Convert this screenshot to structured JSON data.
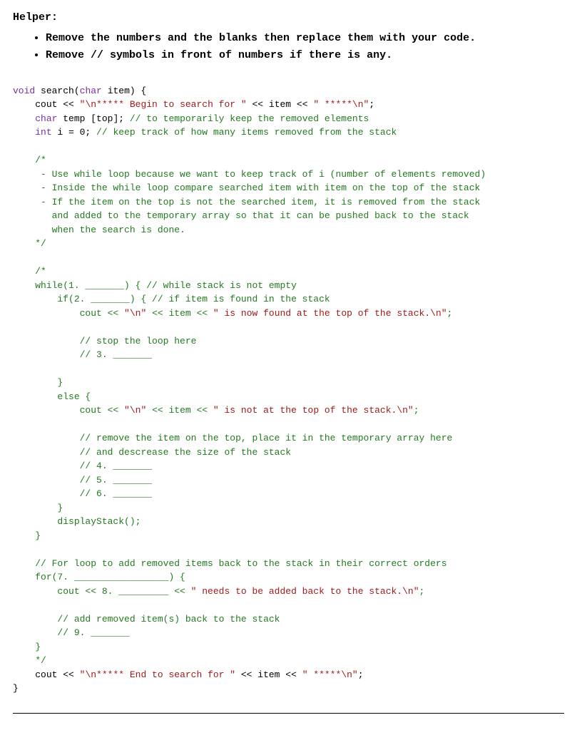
{
  "header": {
    "title": "Helper:",
    "bullets": [
      "Remove the numbers and the blanks then replace them with your code.",
      "Remove // symbols in front of numbers if there is any."
    ]
  },
  "code": {
    "sig_void": "void",
    "sig_name": "search",
    "sig_char": "char",
    "sig_param": "item",
    "l1_cout": "cout << ",
    "l1_str1": "\"\\n***** Begin to search for \"",
    "l1_mid": " << item << ",
    "l1_str2": "\" *****\\n\"",
    "l1_end": ";",
    "l2_char": "char",
    "l2_rest": " temp [top]; ",
    "l2_cmt": "// to temporarily keep the removed elements",
    "l3_int": "int",
    "l3_rest": " i = 0; ",
    "l3_cmt": "// keep track of how many items removed from the stack",
    "block1_open": "/*",
    "block1_a": " - Use while loop because we want to keep track of i (number of elements removed)",
    "block1_b": " - Inside the while loop compare searched item with item on the top of the stack",
    "block1_c": " - If the item on the top is not the searched item, it is removed from the stack",
    "block1_d": "   and added to the temporary array so that it can be pushed back to the stack",
    "block1_e": "   when the search is done.",
    "block1_close": "*/",
    "block2_open": "/*",
    "while_line": "while(1. _______) { // while stack is not empty",
    "if_line": "    if(2. _______) { // if item is found in the stack",
    "found_pre": "        cout << ",
    "found_s1": "\"\\n\"",
    "found_mid": " << item << ",
    "found_s2": "\" is now found at the top of the stack.\\n\"",
    "found_end": ";",
    "stop_cmt": "        // stop the loop here",
    "blank3": "        // 3. _______",
    "close_if": "    }",
    "else_line": "    else {",
    "nfound_pre": "        cout << ",
    "nfound_s1": "\"\\n\"",
    "nfound_mid": " << item << ",
    "nfound_s2": "\" is not at the top of the stack.\\n\"",
    "nfound_end": ";",
    "rem_cmt1": "        // remove the item on the top, place it in the temporary array here",
    "rem_cmt2": "        // and descrease the size of the stack",
    "blank4": "        // 4. _______",
    "blank5": "        // 5. _______",
    "blank6": "        // 6. _______",
    "close_else": "    }",
    "display": "    displayStack();",
    "close_while": "}",
    "for_cmt": "// For loop to add removed items back to the stack in their correct orders",
    "for_line": "for(7. _________________) {",
    "back_pre": "    cout << 8. _________ << ",
    "back_str": "\" needs to be added back to the stack.\\n\"",
    "back_end": ";",
    "add_cmt": "    // add removed item(s) back to the stack",
    "blank9": "    // 9. _______",
    "close_for": "}",
    "block2_close": "*/",
    "end_pre": "cout << ",
    "end_s1": "\"\\n***** End to search for \"",
    "end_mid": " << item << ",
    "end_s2": "\" *****\\n\"",
    "end_end": ";"
  }
}
